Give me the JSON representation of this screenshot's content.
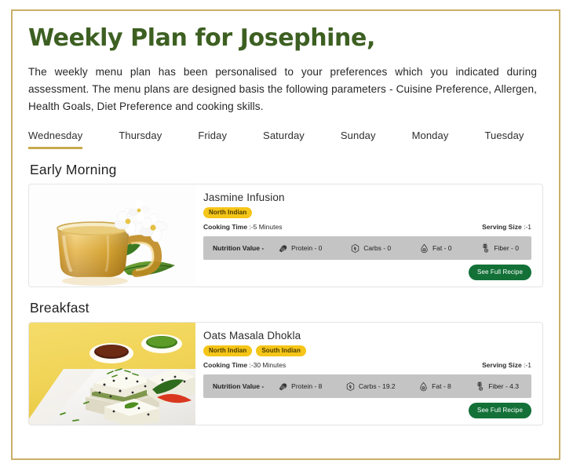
{
  "theme": {
    "border_color": "#c9b06a",
    "title_color": "#3d6022",
    "tab_underline_color": "#c9a94e",
    "tag_bg": "#f5c518",
    "button_bg": "#137138",
    "nutrition_bar_bg": "#c4c4c4"
  },
  "header": {
    "title": "Weekly Plan for Josephine,",
    "intro": "The weekly menu plan has been personalised to your preferences which you indicated during assessment. The menu plans are designed basis the following parameters - Cuisine Preference, Allergen, Health Goals, Diet Preference and cooking skills."
  },
  "day_tabs": [
    {
      "label": "Wednesday",
      "active": true
    },
    {
      "label": "Thursday",
      "active": false
    },
    {
      "label": "Friday",
      "active": false
    },
    {
      "label": "Saturday",
      "active": false
    },
    {
      "label": "Sunday",
      "active": false
    },
    {
      "label": "Monday",
      "active": false
    },
    {
      "label": "Tuesday",
      "active": false
    }
  ],
  "sections": [
    {
      "title": "Early Morning",
      "recipe": {
        "name": "Jasmine Infusion",
        "image": "jasmine-tea-cup",
        "tags": [
          "North Indian"
        ],
        "cooking_time_label": "Cooking Time",
        "cooking_time_value": ":-5 Minutes",
        "serving_size_label": "Serving Size",
        "serving_size_value": ":-1",
        "nutrition_label": "Nutrition Value -",
        "nutrition": [
          {
            "icon": "protein-icon",
            "text": "Protein - 0"
          },
          {
            "icon": "carbs-icon",
            "text": "Carbs - 0"
          },
          {
            "icon": "fat-icon",
            "text": "Fat - 0"
          },
          {
            "icon": "fiber-icon",
            "text": "Fiber - 0"
          }
        ],
        "button_label": "See Full Recipe"
      }
    },
    {
      "title": "Breakfast",
      "recipe": {
        "name": "Oats Masala Dhokla",
        "image": "dhokla-plate",
        "tags": [
          "North Indian",
          "South Indian"
        ],
        "cooking_time_label": "Cooking Time",
        "cooking_time_value": ":-30 Minutes",
        "serving_size_label": "Serving Size",
        "serving_size_value": ":-1",
        "nutrition_label": "Nutrition Value -",
        "nutrition": [
          {
            "icon": "protein-icon",
            "text": "Protein - 8"
          },
          {
            "icon": "carbs-icon",
            "text": "Carbs - 19.2"
          },
          {
            "icon": "fat-icon",
            "text": "Fat - 8"
          },
          {
            "icon": "fiber-icon",
            "text": "Fiber - 4.3"
          }
        ],
        "button_label": "See Full Recipe"
      }
    }
  ]
}
